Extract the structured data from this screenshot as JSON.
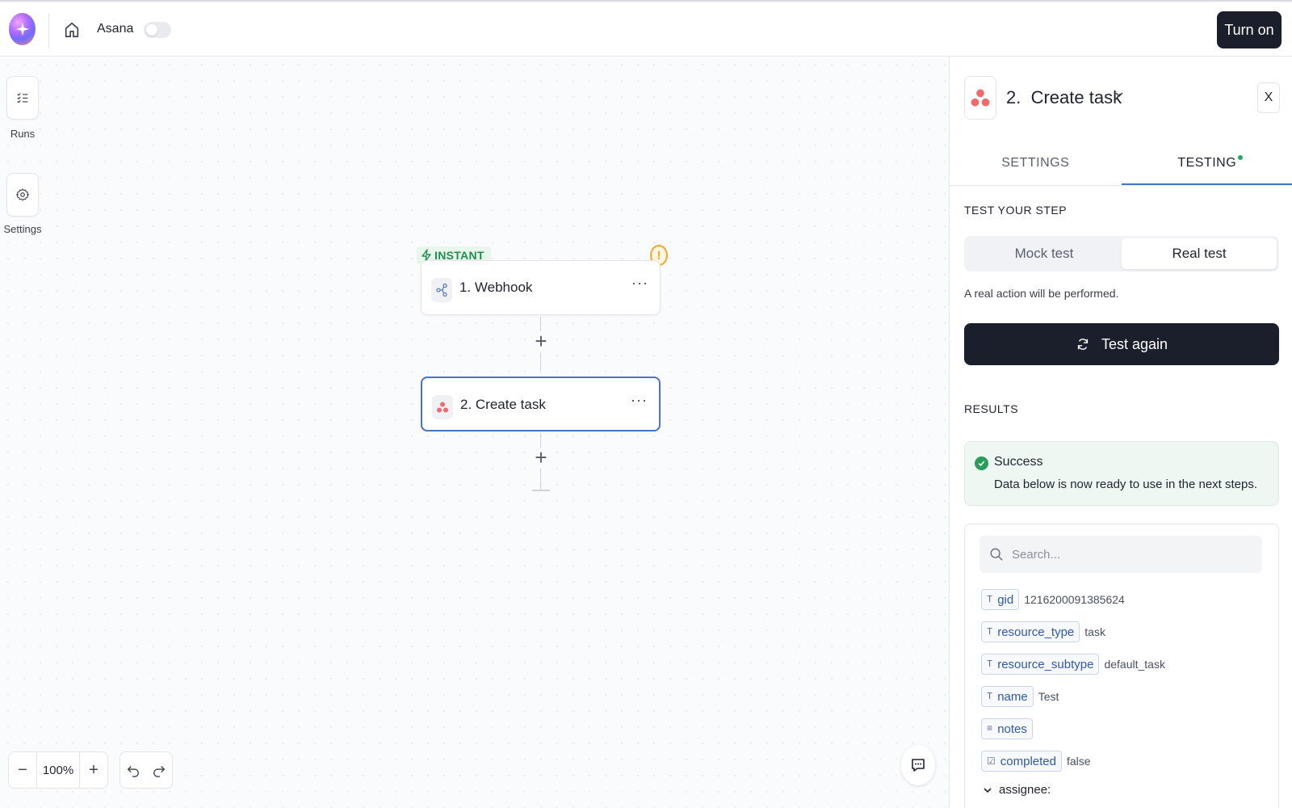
{
  "topbar": {
    "flow_name": "Asana",
    "turn_on_label": "Turn on"
  },
  "sidebar": {
    "runs_label": "Runs",
    "settings_label": "Settings"
  },
  "canvas": {
    "trigger_badge": "INSTANT",
    "steps": [
      {
        "title": "1. Webhook",
        "icon": "webhook-icon"
      },
      {
        "title": "2. Create task",
        "icon": "asana-icon"
      }
    ],
    "more_label": "···",
    "zoom": "100%"
  },
  "panel": {
    "step_number": "2.",
    "title": "Create task",
    "close_label": "X",
    "tabs": {
      "settings": "SETTINGS",
      "testing": "TESTING"
    },
    "test_section_label": "TEST YOUR STEP",
    "mock_test_label": "Mock test",
    "real_test_label": "Real test",
    "real_note": "A real action will be performed.",
    "test_again_label": "Test again",
    "results_label": "RESULTS",
    "success_title": "Success",
    "success_desc": "Data below is now ready to use in the next steps.",
    "search_placeholder": "Search...",
    "fields": [
      {
        "key": "gid",
        "value": "1216200091385624",
        "type_icon": "text-type-icon"
      },
      {
        "key": "resource_type",
        "value": "task",
        "type_icon": "text-type-icon"
      },
      {
        "key": "resource_subtype",
        "value": "default_task",
        "type_icon": "text-type-icon"
      },
      {
        "key": "name",
        "value": "Test",
        "type_icon": "text-type-icon"
      },
      {
        "key": "notes",
        "value": "",
        "type_icon": "rich-text-icon"
      },
      {
        "key": "completed",
        "value": "false",
        "type_icon": "checkbox-icon"
      }
    ],
    "assignee_label": "assignee:"
  },
  "colors": {
    "accent": "#4a74c7",
    "dark_button": "#1b1f2b",
    "success": "#2a9d5c",
    "instant_green": "#1f8f4e",
    "warning": "#f0a92e"
  }
}
